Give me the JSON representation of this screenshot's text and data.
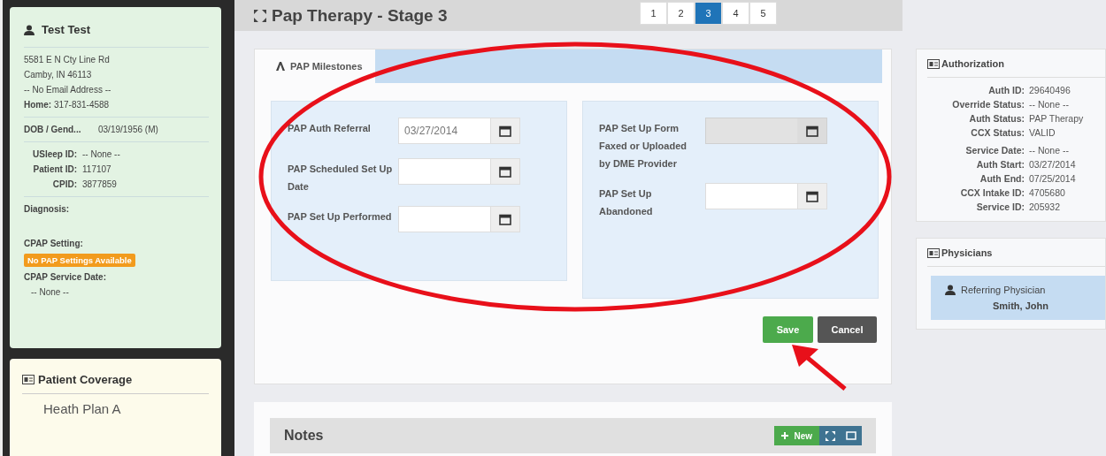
{
  "patient": {
    "name": "Test Test",
    "address_lines": [
      "5581 E N Cty Line Rd",
      "Camby, IN 46113",
      "-- No Email Address --"
    ],
    "home_label": "Home:",
    "home_value": "317-831-4588",
    "dob_label": "DOB / Gend...",
    "dob_value": "03/19/1956 (M)",
    "ids": [
      {
        "label": "USleep ID:",
        "value": "-- None --"
      },
      {
        "label": "Patient ID:",
        "value": "117107"
      },
      {
        "label": "CPID:",
        "value": "3877859"
      }
    ],
    "diagnosis_label": "Diagnosis:",
    "cpap_setting_label": "CPAP Setting:",
    "cpap_badge": "No PAP Settings Available",
    "cpap_service_label": "CPAP Service Date:",
    "cpap_service_value": "-- None --"
  },
  "coverage": {
    "title": "Patient Coverage",
    "plan": "Heath Plan A"
  },
  "page": {
    "title": "Pap Therapy - Stage 3",
    "pages": [
      {
        "label": "1",
        "selected": false
      },
      {
        "label": "2",
        "selected": false
      },
      {
        "label": "3",
        "selected": true
      },
      {
        "label": "4",
        "selected": false
      },
      {
        "label": "5",
        "selected": false
      }
    ]
  },
  "tabs": [
    {
      "label": "PAP Milestones",
      "selected": true
    }
  ],
  "left_fields": [
    {
      "label": "PAP Auth Referral",
      "value": "03/27/2014",
      "disabled": false
    },
    {
      "label": "PAP Scheduled Set Up Date",
      "disabled": false
    },
    {
      "label": "PAP Set Up Performed",
      "disabled": false
    }
  ],
  "right_fields": [
    {
      "label": "PAP Set Up Form Faxed or Uploaded by DME Provider",
      "disabled": true
    },
    {
      "label": "PAP Set Up Abandoned",
      "disabled": false
    }
  ],
  "buttons": {
    "save": "Save",
    "cancel": "Cancel"
  },
  "notes": {
    "title": "Notes",
    "new_button": "New"
  },
  "authorization": {
    "title": "Authorization",
    "groups": [
      [
        {
          "label": "Auth ID:",
          "value": "29640496"
        },
        {
          "label": "Override Status:",
          "value": "-- None --"
        },
        {
          "label": "Auth Status:",
          "value": "PAP Therapy"
        },
        {
          "label": "CCX Status:",
          "value": "VALID"
        }
      ],
      [
        {
          "label": "Service Date:",
          "value": "-- None --"
        },
        {
          "label": "Auth Start:",
          "value": "03/27/2014"
        },
        {
          "label": "Auth End:",
          "value": "07/25/2014"
        },
        {
          "label": "CCX Intake ID:",
          "value": "4705680"
        },
        {
          "label": "Service ID:",
          "value": "205932"
        }
      ]
    ]
  },
  "physicians": {
    "title": "Physicians",
    "role": "Referring Physician",
    "name": "Smith, John"
  }
}
